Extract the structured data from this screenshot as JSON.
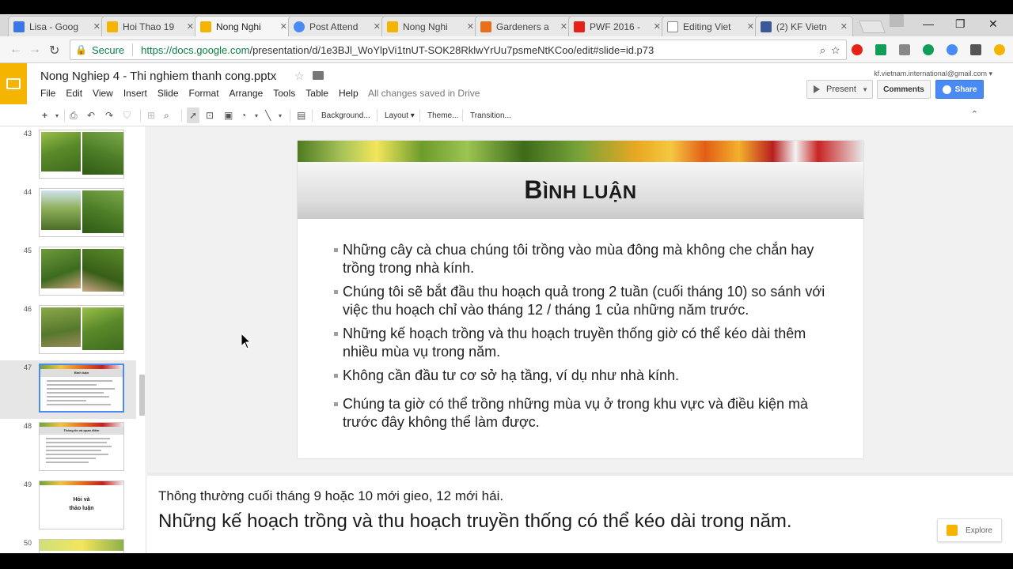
{
  "browser": {
    "tabs": [
      {
        "title": "Lisa - Goog",
        "favicon_color": "#3b78e7"
      },
      {
        "title": "Hoi Thao 19",
        "favicon_color": "#f4b400"
      },
      {
        "title": "Nong Nghi",
        "favicon_color": "#f4b400"
      },
      {
        "title": "Post Attend",
        "favicon_color": "#4a8af4"
      },
      {
        "title": "Nong Nghi",
        "favicon_color": "#f4b400"
      },
      {
        "title": "Gardeners a",
        "favicon_color": "#e8701b"
      },
      {
        "title": "PWF 2016 -",
        "favicon_color": "#e62117"
      },
      {
        "title": "Editing Viet",
        "favicon_color": "#888888"
      },
      {
        "title": "(2) KF Vietn",
        "favicon_color": "#3b5998"
      }
    ],
    "active_tab_index": 2,
    "secure_label": "Secure",
    "url_host": "https://docs.google.com",
    "url_path": "/presentation/d/1e3BJl_WoYlpVi1tnUT-SOK28RklwYrUu7psmeNtKCoo/edit#slide=id.p73"
  },
  "docs": {
    "title": "Nong Nghiep 4 - Thi nghiem thanh cong.pptx",
    "menu": [
      "File",
      "Edit",
      "View",
      "Insert",
      "Slide",
      "Format",
      "Arrange",
      "Tools",
      "Table",
      "Help"
    ],
    "save_status": "All changes saved in Drive",
    "account": "kf.vietnam.international@gmail.com",
    "present_label": "Present",
    "comments_label": "Comments",
    "share_label": "Share",
    "accent_color": "#f4b400"
  },
  "toolbar": {
    "background_label": "Background...",
    "layout_label": "Layout",
    "theme_label": "Theme...",
    "transition_label": "Transition..."
  },
  "filmstrip": {
    "slides": [
      {
        "num": "43",
        "kind": "photos"
      },
      {
        "num": "44",
        "kind": "photos"
      },
      {
        "num": "45",
        "kind": "photos"
      },
      {
        "num": "46",
        "kind": "photos"
      },
      {
        "num": "47",
        "kind": "text",
        "selected": true,
        "thumb_title": "Bình luận"
      },
      {
        "num": "48",
        "kind": "text",
        "thumb_title": "Thông tin và quan điểm"
      },
      {
        "num": "49",
        "kind": "title",
        "thumb_title": "Hỏi và thảo luận"
      },
      {
        "num": "50",
        "kind": "text"
      }
    ],
    "thumb_49_line1": "Hỏi và",
    "thumb_49_line2": "thảo luận"
  },
  "slide": {
    "title_first": "B",
    "title_rest": "ình luận",
    "bullets": [
      "Những cây cà chua chúng tôi trồng vào mùa đông mà không che chắn hay trồng trong nhà kính.",
      "Chúng tôi sẽ bắt đầu thu hoạch quả trong 2 tuần (cuối tháng 10) so sánh với việc thu hoạch chỉ vào tháng 12 / tháng 1 của những năm trước.",
      "Những kế hoạch trồng và thu hoạch truyền thống giờ có thể kéo dài thêm nhiều mùa vụ trong năm.",
      "Không cần đầu tư cơ sở hạ tầng, ví dụ như nhà kính.",
      "Chúng ta giờ có thể trồng những mùa vụ ở trong khu vực và điều kiện mà trước đây không thể làm được."
    ]
  },
  "notes": {
    "line1": "Thông thường cuối tháng 9 hoặc 10 mới gieo, 12 mới hái.",
    "line2": "Những kế hoạch trồng và thu hoạch truyền thống có thể kéo dài trong năm."
  },
  "explore_label": "Explore"
}
